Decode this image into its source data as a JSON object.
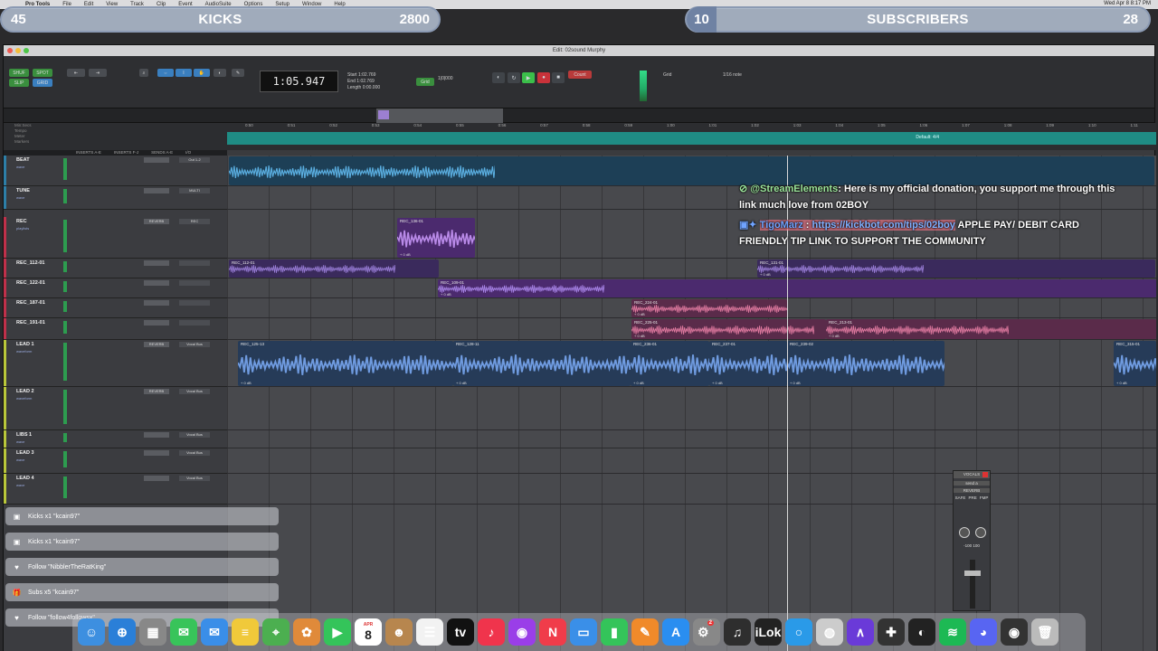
{
  "menubar": {
    "app": "Pro Tools",
    "items": [
      "File",
      "Edit",
      "View",
      "Track",
      "Clip",
      "Event",
      "AudioSuite",
      "Options",
      "Setup",
      "Window",
      "Help"
    ],
    "clock": "Wed Apr 8  8:17 PM"
  },
  "overlay": {
    "kicks": {
      "count": "45",
      "label": "KICKS",
      "goal": "2800"
    },
    "subs": {
      "count": "10",
      "label": "SUBSCRIBERS",
      "goal": "28"
    }
  },
  "window": {
    "title": "Edit: 02sound Murphy",
    "counter": "1:05.947",
    "selection": {
      "start": "1:02.769",
      "end": "1:02.769",
      "length": "0:00.000"
    },
    "grid": "1/16 note",
    "nudge": "1|0|000",
    "tempo_label": "Default: 4/4",
    "column_headers": [
      "INSERTS A-E",
      "INSERTS F-J",
      "SENDS A-E",
      "I/O"
    ]
  },
  "ruler": {
    "labels": [
      "Min:Secs",
      "Tempo",
      "Meter",
      "Markers"
    ],
    "ticks": [
      "0:50",
      "0:51",
      "0:52",
      "0:53",
      "0:54",
      "0:55",
      "0:56",
      "0:57",
      "0:58",
      "0:59",
      "1:00",
      "1:01",
      "1:02",
      "1:03",
      "1:04",
      "1:05",
      "1:06",
      "1:07",
      "1:08",
      "1:09",
      "1:10",
      "1:11"
    ]
  },
  "tracks": [
    {
      "name": "BEAT",
      "color": "#2d7fa8",
      "send": "",
      "io": "Out 1-2",
      "mode": "wave"
    },
    {
      "name": "TUNE",
      "color": "#2d7fa8",
      "send": "",
      "io": "MULTI",
      "mode": "wave"
    },
    {
      "name": "REC",
      "color": "#c0304a",
      "send": "REVERB",
      "io": "REC",
      "mode": "playlists"
    },
    {
      "name": "REC_112-01",
      "color": "#c0304a",
      "send": "",
      "io": "",
      "mode": ""
    },
    {
      "name": "REC_122-01",
      "color": "#c0304a",
      "send": "",
      "io": "",
      "mode": ""
    },
    {
      "name": "REC_187-01",
      "color": "#c0304a",
      "send": "",
      "io": "",
      "mode": ""
    },
    {
      "name": "REC_191-01",
      "color": "#c0304a",
      "send": "",
      "io": "",
      "mode": ""
    },
    {
      "name": "LEAD 1",
      "color": "#b9c73a",
      "send": "REVERB",
      "io": "Vocal Bus",
      "mode": "waveform"
    },
    {
      "name": "LEAD 2",
      "color": "#b9c73a",
      "send": "REVERB",
      "io": "Vocal Bus",
      "mode": "waveform"
    },
    {
      "name": "LIBS 1",
      "color": "#b9c73a",
      "send": "",
      "io": "Vocal Bus",
      "mode": "wave"
    },
    {
      "name": "LEAD 3",
      "color": "#b9c73a",
      "send": "",
      "io": "Vocal Bus",
      "mode": "wave"
    },
    {
      "name": "LEAD 4",
      "color": "#b9c73a",
      "send": "",
      "io": "Vocal Bus",
      "mode": "wave"
    }
  ],
  "clips": [
    {
      "name": "REC_136-01",
      "gain": "+ 0 dB"
    },
    {
      "name": "REC_112-01",
      "gain": ""
    },
    {
      "name": "REC_131-01",
      "gain": "+ 0 dB"
    },
    {
      "name": "REC_109-01",
      "gain": "+ 0 dB"
    },
    {
      "name": "REC_224-01",
      "gain": "+ 0 dB"
    },
    {
      "name": "REC_225-01",
      "gain": "+ 0 dB"
    },
    {
      "name": "REC_213-01",
      "gain": "+ 0 dB"
    },
    {
      "name": "REC_125-13",
      "gain": "+ 0 dB"
    },
    {
      "name": "REC_128-11",
      "gain": "+ 0 dB"
    },
    {
      "name": "REC_236-01",
      "gain": "+ 0 dB"
    },
    {
      "name": "REC_237-01",
      "gain": "+ 0 dB"
    },
    {
      "name": "REC_239-02",
      "gain": "+ 0 dB"
    },
    {
      "name": "REC_315-01",
      "gain": "+ 0 dB"
    }
  ],
  "chat": {
    "msg1": {
      "user": "@StreamElements",
      "text": ": Here is my official donation, you support me through this link much love from 02BOY"
    },
    "msg2": {
      "user": "TigoMarz",
      "link": "https://kickbot.com/tips/02boy",
      "text": " APPLE PAY/ DEBIT CARD FRIENDLY TIP LINK TO SUPPORT THE COMMUNITY"
    }
  },
  "alerts": [
    {
      "icon": "kick",
      "text": "Kicks x1 \"kcain97\""
    },
    {
      "icon": "kick",
      "text": "Kicks x1 \"kcain97\""
    },
    {
      "icon": "heart",
      "text": "Follow \"NibblerTheRatKing\""
    },
    {
      "icon": "gift",
      "text": "Subs x5 \"kcain97\""
    },
    {
      "icon": "heart",
      "text": "Follow \"follow4followsx\""
    }
  ],
  "mini_mixer": {
    "title": "VOCALS",
    "send": "send a",
    "insert": "REVERB",
    "buttons": [
      "SAFE",
      "PRE",
      "FMP"
    ],
    "pan": "-100 100"
  },
  "dock": {
    "calendar_date": "8",
    "calendar_month": "APR",
    "badge": "2"
  }
}
